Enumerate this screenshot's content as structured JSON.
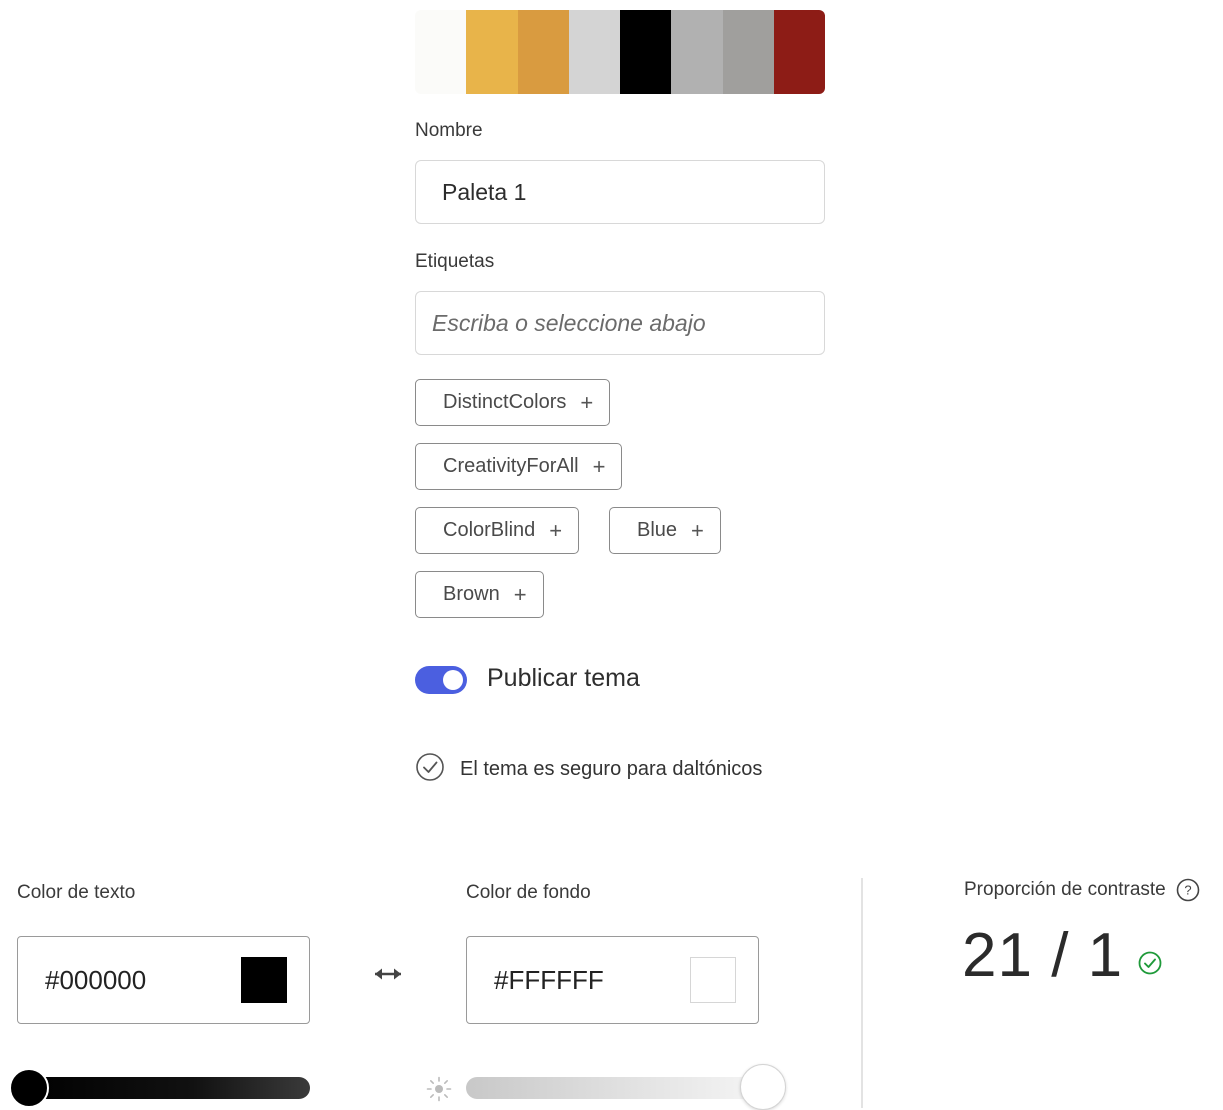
{
  "palette": {
    "swatches": [
      "#fbfbf9",
      "#e8b44a",
      "#d99b40",
      "#d4d4d4",
      "#000000",
      "#b1b1b1",
      "#a09f9d",
      "#8d1c16"
    ]
  },
  "form": {
    "name_label": "Nombre",
    "name_value": "Paleta 1",
    "tags_label": "Etiquetas",
    "tags_placeholder": "Escriba o seleccione abajo",
    "suggested_tags": [
      "DistinctColors",
      "CreativityForAll",
      "ColorBlind",
      "Blue",
      "Brown"
    ],
    "tag_add_symbol": "+",
    "publish_label": "Publicar tema",
    "publish_on": true,
    "colorblind_safe_text": "El tema es seguro para daltónicos"
  },
  "contrast": {
    "text_color_label": "Color de texto",
    "text_color_value": "#000000",
    "text_color_swatch": "#000000",
    "bg_color_label": "Color de fondo",
    "bg_color_value": "#FFFFFF",
    "bg_color_swatch": "#FFFFFF",
    "swap_symbol": "↔",
    "ratio_label": "Proporción de contraste",
    "help_symbol": "?",
    "ratio_value": "21 / 1",
    "ratio_pass": true,
    "text_brightness": 0,
    "bg_brightness": 1,
    "accent_color": "#4b5fe0",
    "pass_color": "#1f9a3a"
  }
}
